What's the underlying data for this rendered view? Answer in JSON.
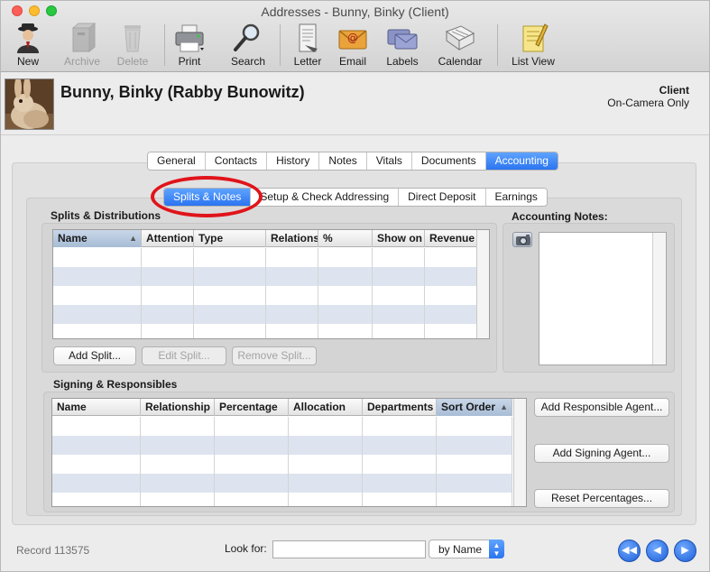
{
  "window": {
    "title": "Addresses - Bunny, Binky (Client)"
  },
  "toolbar": {
    "items": [
      {
        "label": "New",
        "icon": "new-person-icon",
        "enabled": true
      },
      {
        "label": "Archive",
        "icon": "archive-box-icon",
        "enabled": false
      },
      {
        "label": "Delete",
        "icon": "trash-can-icon",
        "enabled": false
      },
      {
        "label": "Print",
        "icon": "printer-icon",
        "enabled": true
      },
      {
        "label": "Search",
        "icon": "magnifier-icon",
        "enabled": true
      },
      {
        "label": "Letter",
        "icon": "letter-icon",
        "enabled": true
      },
      {
        "label": "Email",
        "icon": "email-envelope-icon",
        "enabled": true
      },
      {
        "label": "Labels",
        "icon": "labels-envelope-icon",
        "enabled": true
      },
      {
        "label": "Calendar",
        "icon": "calendar-icon",
        "enabled": true
      },
      {
        "label": "List View",
        "icon": "notepad-list-icon",
        "enabled": true
      }
    ]
  },
  "header": {
    "name": "Bunny, Binky (Rabby Bunowitz)",
    "client_type": "Client",
    "client_subtype": "On-Camera Only"
  },
  "tabs": {
    "main": [
      "General",
      "Contacts",
      "History",
      "Notes",
      "Vitals",
      "Documents",
      "Accounting"
    ],
    "main_active": "Accounting",
    "sub": [
      "Splits & Notes",
      "Setup & Check Addressing",
      "Direct Deposit",
      "Earnings"
    ],
    "sub_active": "Splits & Notes"
  },
  "splits": {
    "title": "Splits & Distributions",
    "columns": [
      "Name",
      "Attention",
      "Type",
      "Relations",
      "%",
      "Show on",
      "Revenue"
    ],
    "sorted_column": "Name",
    "buttons": {
      "add": "Add Split...",
      "edit": "Edit Split...",
      "remove": "Remove Split..."
    }
  },
  "accounting_notes": {
    "title": "Accounting Notes:",
    "value": ""
  },
  "signing": {
    "title": "Signing & Responsibles",
    "columns": [
      "Name",
      "Relationship",
      "Percentage",
      "Allocation",
      "Departments",
      "Sort Order"
    ],
    "sorted_column": "Sort Order",
    "buttons": {
      "add_responsible": "Add Responsible Agent...",
      "add_signing": "Add Signing Agent...",
      "reset": "Reset Percentages..."
    }
  },
  "footer": {
    "record": "Record 113575",
    "look_for_label": "Look for:",
    "look_for_value": "",
    "search_by": "by Name"
  },
  "colors": {
    "accent": "#2a74f0",
    "highlight_ring": "#e0141a",
    "alt_row": "#dde4ef"
  }
}
